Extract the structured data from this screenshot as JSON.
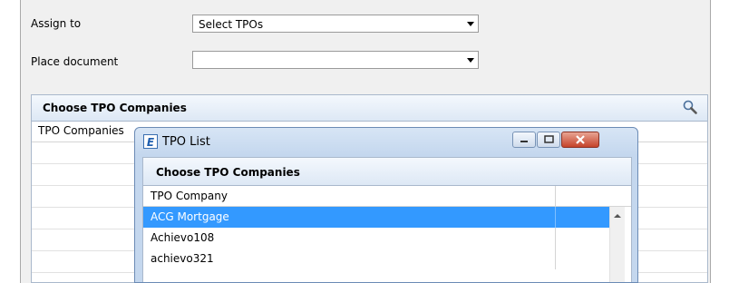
{
  "form": {
    "assign_to_label": "Assign to",
    "assign_to_value": "Select TPOs",
    "place_document_label": "Place document",
    "place_document_value": ""
  },
  "panel": {
    "title": "Choose TPO Companies",
    "column_header": "TPO Companies",
    "search_icon": "magnifier-icon"
  },
  "popup": {
    "window_title": "TPO List",
    "app_icon_letter": "E",
    "section_title": "Choose TPO Companies",
    "column_header": "TPO Company",
    "rows": [
      {
        "name": "ACG Mortgage",
        "selected": true
      },
      {
        "name": "Achievo108",
        "selected": false
      },
      {
        "name": "achievo321",
        "selected": false
      }
    ]
  },
  "colors": {
    "selection": "#3399ff",
    "panel_border": "#a9b8cc"
  }
}
